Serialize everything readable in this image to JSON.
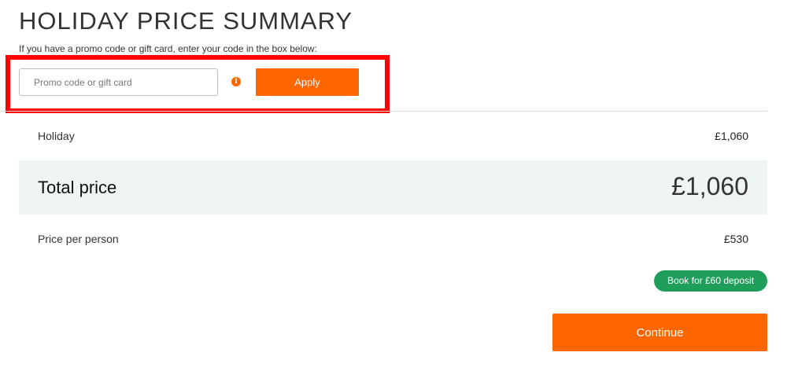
{
  "header": {
    "title": "HOLIDAY PRICE SUMMARY"
  },
  "promo": {
    "instruction": "If you have a promo code or gift card, enter your code in the box below:",
    "input_value": "",
    "placeholder": "Promo code or gift card",
    "info_icon": "info-icon",
    "info_glyph": "i",
    "apply_label": "Apply"
  },
  "summary": {
    "holiday_label": "Holiday",
    "holiday_value": "£1,060",
    "total_label": "Total price",
    "total_value": "£1,060",
    "per_person_label": "Price per person",
    "per_person_value": "£530"
  },
  "deposit": {
    "label": "Book for £60 deposit"
  },
  "actions": {
    "continue_label": "Continue"
  },
  "colors": {
    "accent": "#ff6600",
    "deposit_badge": "#1e9e5a",
    "highlight": "#ff0000",
    "total_band": "#eff4f4"
  }
}
